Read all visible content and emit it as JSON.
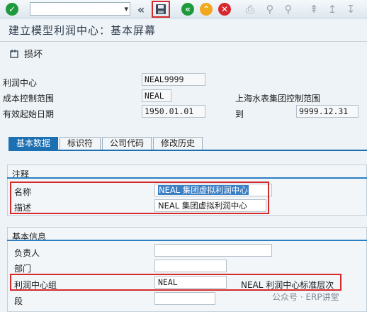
{
  "toolbar": {
    "icons": [
      "enter-icon",
      "command-field",
      "back-arrows-icon",
      "save-icon",
      "back-icon",
      "exit-icon",
      "cancel-icon",
      "print-icon",
      "find-icon",
      "find-next-icon",
      "first-page-icon",
      "previous-page-icon"
    ],
    "command_value": ""
  },
  "title": "建立模型利润中心：基本屏幕",
  "action": {
    "label": "损坏"
  },
  "header": {
    "profit_center_label": "利润中心",
    "profit_center_value": "NEAL9999",
    "controlling_area_label": "成本控制范围",
    "controlling_area_value": "NEAL",
    "controlling_area_desc": "上海水表集团控制范围",
    "valid_from_label": "有效起始日期",
    "valid_from_value": "1950.01.01",
    "to_label": "到",
    "valid_to_value": "9999.12.31"
  },
  "tabs": [
    "基本数据",
    "标识符",
    "公司代码",
    "修改历史"
  ],
  "notes_group": {
    "title": "注释",
    "name_label": "名称",
    "name_value": "NEAL 集团虚拟利润中心",
    "desc_label": "描述",
    "desc_value": "NEAL 集团虚拟利润中心"
  },
  "basic_group": {
    "title": "基本信息",
    "owner_label": "负责人",
    "owner_value": "",
    "dept_label": "部门",
    "dept_value": "",
    "pc_group_label": "利润中心组",
    "pc_group_value": "NEAL",
    "pc_group_desc": "NEAL 利润中心标准层次",
    "segment_label": "段",
    "segment_value": ""
  },
  "watermark": "公众号 · ERP讲堂",
  "colors": {
    "accent": "#1c6fb0",
    "highlight_frame": "#d42a2a"
  }
}
